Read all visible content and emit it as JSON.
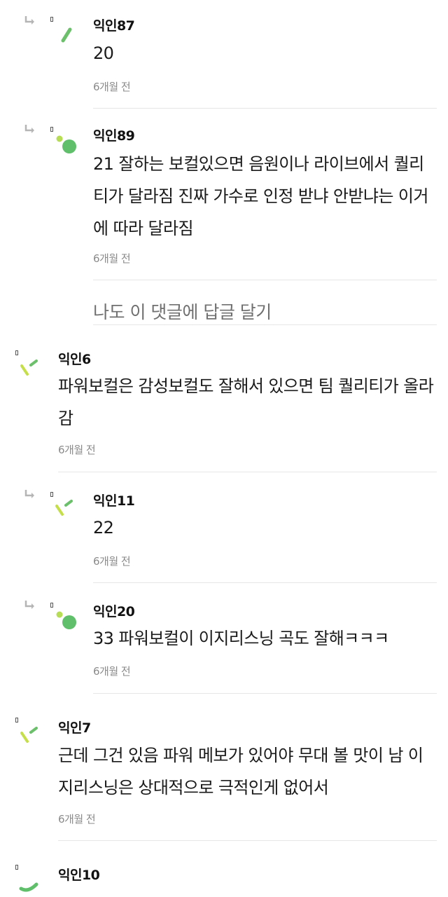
{
  "comments": [
    {
      "author": "익인87",
      "text": "20",
      "time": "6개월 전",
      "is_reply": true,
      "avatar": "green-stroke-avatar"
    },
    {
      "author": "익인89",
      "text": "21 잘하는 보컬있으면 음원이나 라이브에서 퀄리티가 달라짐 진짜 가수로 인정 받냐 안받냐는 이거에 따라 달라짐",
      "time": "6개월 전",
      "is_reply": true,
      "avatar": "green-dots-avatar"
    },
    {
      "author": "익인6",
      "text": "파워보컬은 감성보컬도 잘해서 있으면 팀 퀄리티가 올라감",
      "time": "6개월 전",
      "is_reply": false,
      "avatar": "lime-strokes-avatar"
    },
    {
      "author": "익인11",
      "text": "22",
      "time": "6개월 전",
      "is_reply": true,
      "avatar": "lime-strokes-avatar"
    },
    {
      "author": "익인20",
      "text": "33 파워보컬이 이지리스닝 곡도 잘해ㅋㅋㅋ",
      "time": "6개월 전",
      "is_reply": true,
      "avatar": "green-dots-avatar"
    },
    {
      "author": "익인7",
      "text": "근데 그건 있음 파워 메보가 있어야 무대 볼 맛이 남 이지리스닝은 상대적으로 극적인게 없어서",
      "time": "6개월 전",
      "is_reply": false,
      "avatar": "lime-strokes-avatar"
    },
    {
      "author": "익인10",
      "text": "",
      "time": "",
      "is_reply": false,
      "avatar": "green-arc-avatar"
    }
  ],
  "reply_link": "나도 이 댓글에 답글 달기"
}
